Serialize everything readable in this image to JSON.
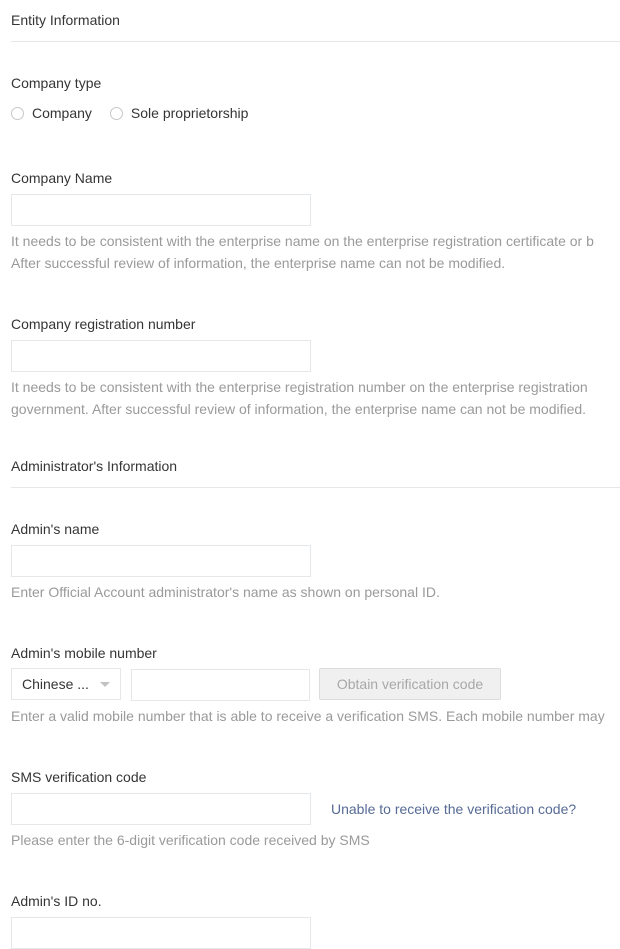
{
  "entity_section": {
    "title": "Entity Information"
  },
  "company_type": {
    "label": "Company type",
    "options": [
      "Company",
      "Sole proprietorship"
    ]
  },
  "company_name": {
    "label": "Company Name",
    "value": "",
    "help_line1": "It needs to be consistent with the enterprise name on the enterprise registration certificate or b",
    "help_line2": "After successful review of information, the enterprise name can not be modified."
  },
  "registration_number": {
    "label": "Company registration number",
    "value": "",
    "help_line1": "It needs to be consistent with the enterprise registration number on the enterprise registration",
    "help_line2": "government. After successful review of information, the enterprise name can not be modified."
  },
  "admin_section": {
    "title": "Administrator's Information"
  },
  "admin_name": {
    "label": "Admin's name",
    "value": "",
    "help": "Enter Official Account administrator's name as shown on personal ID."
  },
  "admin_mobile": {
    "label": "Admin's mobile number",
    "country_selected": "Chinese ...",
    "value": "",
    "obtain_button": "Obtain verification code",
    "help": "Enter a valid mobile number that is able to receive a verification SMS. Each mobile number may"
  },
  "sms_code": {
    "label": "SMS verification code",
    "value": "",
    "unable_link": "Unable to receive the verification code?",
    "help": "Please enter the 6-digit verification code received by SMS"
  },
  "admin_id": {
    "label": "Admin's ID no.",
    "value": ""
  },
  "colors": {
    "link": "#576b95",
    "help_text": "#9a9a9a",
    "border": "#e4e8eb"
  }
}
